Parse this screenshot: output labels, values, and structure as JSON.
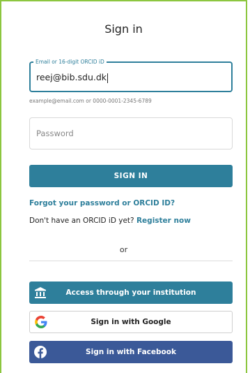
{
  "title": "Sign in",
  "email_field": {
    "label": "Email or 16-digit ORCID iD",
    "value": "reej@bib.sdu.dk",
    "hint": "example@email.com or 0000-0001-2345-6789"
  },
  "password_field": {
    "placeholder": "Password"
  },
  "sign_in_button": "SIGN IN",
  "forgot_link": "Forgot your password or ORCID ID?",
  "register": {
    "prompt": "Don't have an ORCID iD yet?",
    "link": "Register now"
  },
  "or_text": "or",
  "institution_button": "Access through your institution",
  "google_button": "Sign in with Google",
  "facebook_button": "Sign in with Facebook",
  "icons": {
    "institution": "bank-icon",
    "google": "google-icon",
    "facebook": "facebook-icon"
  },
  "colors": {
    "accent": "#2e7f9b",
    "frame": "#8cc63f",
    "facebook": "#3b5998"
  }
}
